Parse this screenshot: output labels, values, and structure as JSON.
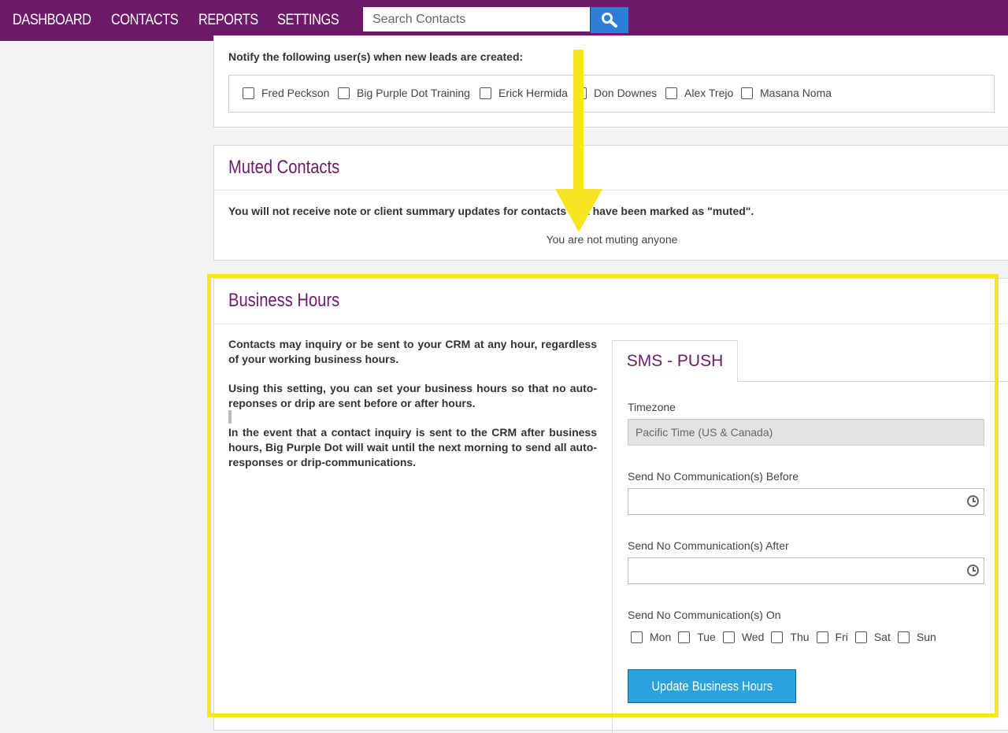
{
  "nav": {
    "items": [
      "DASHBOARD",
      "CONTACTS",
      "REPORTS",
      "SETTINGS"
    ],
    "search_placeholder": "Search Contacts",
    "search_icon": "search-icon"
  },
  "notify": {
    "label": "Notify the following user(s) when new leads are created:",
    "users": [
      "Fred Peckson",
      "Big Purple Dot Training",
      "Erick Hermida",
      "Don Downes",
      "Alex Trejo",
      "Masana Noma"
    ]
  },
  "muted": {
    "title": "Muted Contacts",
    "description": "You will not receive note or client summary updates for contacts that have been marked as \"muted\".",
    "empty_text": "You are not muting anyone"
  },
  "business_hours": {
    "title": "Business Hours",
    "paragraphs": [
      "Contacts may inquiry or be sent to your CRM at any hour, regardless of your working business hours.",
      "Using this setting, you can set your business hours so that no auto-reponses or drip are sent before or after hours.",
      "In the event that a contact inquiry is sent to the CRM after business hours, Big Purple Dot will wait until the next morning to send all auto-responses or drip-communications."
    ],
    "tab_label": "SMS - PUSH",
    "timezone_label": "Timezone",
    "timezone_value": "Pacific Time (US & Canada)",
    "before_label": "Send No Communication(s) Before",
    "before_value": "",
    "after_label": "Send No Communication(s) After",
    "after_value": "",
    "on_label": "Send No Communication(s) On",
    "days": [
      "Mon",
      "Tue",
      "Wed",
      "Thu",
      "Fri",
      "Sat",
      "Sun"
    ],
    "update_button": "Update Business Hours"
  },
  "colors": {
    "brand_purple": "#6d1a6b",
    "search_blue": "#2d7ed4",
    "button_blue": "#2aa3dc",
    "annotation_yellow": "#f6e622"
  }
}
